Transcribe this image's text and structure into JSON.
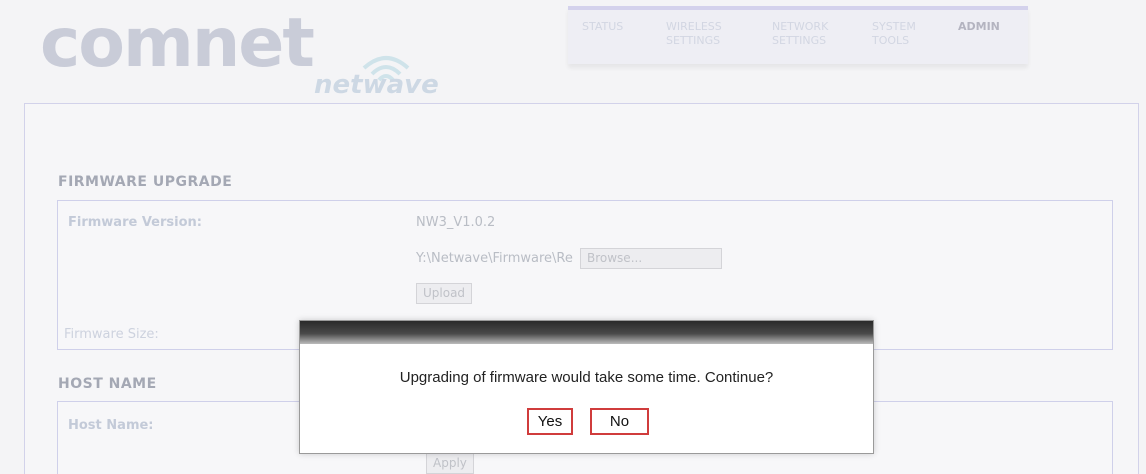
{
  "brand": {
    "name": "comnet",
    "product": "netwave"
  },
  "nav": {
    "items": [
      {
        "label": "STATUS",
        "active": false
      },
      {
        "label": "WIRELESS\nSETTINGS",
        "active": false
      },
      {
        "label": "NETWORK\nSETTINGS",
        "active": false
      },
      {
        "label": "SYSTEM\nTOOLS",
        "active": false
      },
      {
        "label": "ADMIN",
        "active": true
      }
    ]
  },
  "firmware": {
    "title": "FIRMWARE UPGRADE",
    "version_label": "Firmware Version:",
    "version_value": "NW3_V1.0.2",
    "file_path": "Y:\\Netwave\\Firmware\\Re",
    "browse_label": "Browse...",
    "upload_label": "Upload",
    "size_label": "Firmware Size:"
  },
  "host": {
    "title": "HOST NAME",
    "name_label": "Host Name:",
    "apply_label": "Apply"
  },
  "dialog": {
    "message": "Upgrading of firmware would take some time. Continue?",
    "yes_label": "Yes",
    "no_label": "No"
  },
  "colors": {
    "dialog_button_border": "#d03c3c",
    "nav_accent": "#d4d2ec"
  }
}
